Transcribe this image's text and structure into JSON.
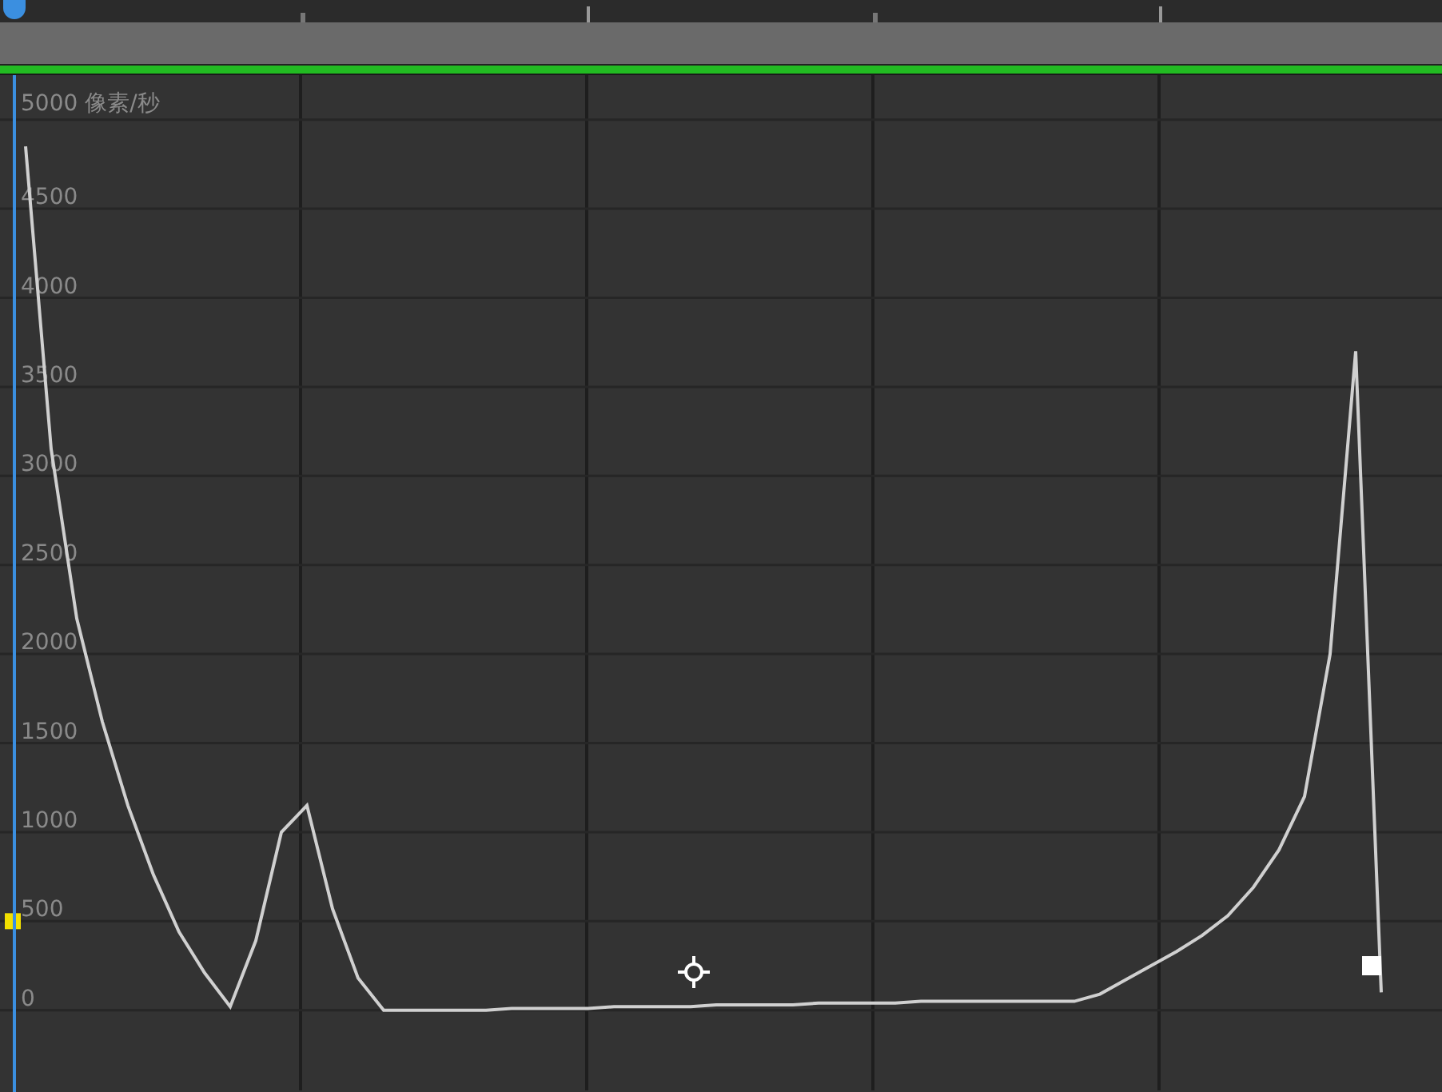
{
  "graph": {
    "unit_label": "5000 像素/秒",
    "chart_data": {
      "type": "line",
      "ylim": [
        -450,
        5250
      ],
      "grid": true,
      "yticks": [
        {
          "value": 4500,
          "label": "4500"
        },
        {
          "value": 4000,
          "label": "4000"
        },
        {
          "value": 3500,
          "label": "3500"
        },
        {
          "value": 3000,
          "label": "3000"
        },
        {
          "value": 2500,
          "label": "2500"
        },
        {
          "value": 2000,
          "label": "2000"
        },
        {
          "value": 1500,
          "label": "1500"
        },
        {
          "value": 1000,
          "label": "1000"
        },
        {
          "value": 500,
          "label": "500"
        },
        {
          "value": 0,
          "label": "0"
        }
      ],
      "categories": [
        null,
        null,
        null,
        null,
        null,
        null,
        null,
        null,
        null,
        null,
        null,
        null,
        null,
        null,
        null,
        null,
        null,
        null,
        null,
        null,
        null,
        null,
        null,
        null,
        null,
        null,
        null,
        null,
        null,
        null,
        null,
        null,
        null,
        null,
        null,
        null,
        null,
        null,
        null,
        null,
        null,
        null,
        null,
        null,
        null,
        null,
        null,
        null,
        null,
        null,
        null,
        null,
        null,
        null,
        null
      ],
      "series": [
        {
          "color": "#d0d0d0",
          "values": [
            null,
            4850,
            3150,
            2200,
            1620,
            1150,
            760,
            440,
            210,
            20,
            390,
            1000,
            1150,
            570,
            180,
            0,
            0,
            0,
            0,
            0,
            10,
            10,
            10,
            10,
            20,
            20,
            20,
            20,
            30,
            30,
            30,
            30,
            40,
            40,
            40,
            40,
            50,
            50,
            50,
            50,
            50,
            50,
            50,
            90,
            170,
            250,
            330,
            420,
            530,
            690,
            900,
            1200,
            2000,
            3700,
            100
          ]
        }
      ]
    }
  }
}
